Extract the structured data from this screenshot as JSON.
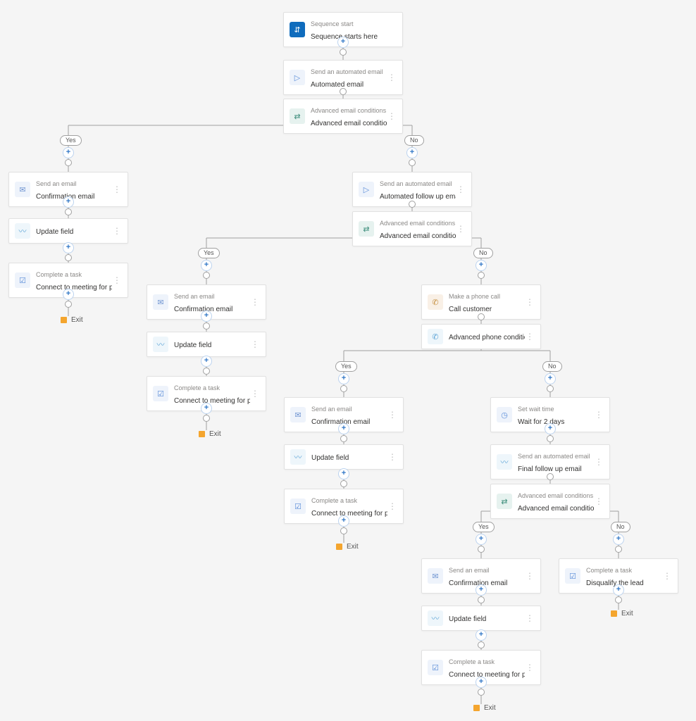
{
  "nodes": {
    "start": {
      "top": "Sequence start",
      "bottom": "Sequence starts here"
    },
    "auto1": {
      "top": "Send an automated email",
      "bottom": "Automated email"
    },
    "cond1": {
      "top": "Advanced email conditions",
      "bottom": "Advanced email conditions"
    },
    "yes1_mail": {
      "top": "Send an email",
      "bottom": "Confirmation email"
    },
    "yes1_upd": {
      "top": "",
      "bottom": "Update field"
    },
    "yes1_task": {
      "top": "Complete a task",
      "bottom": "Connect to meeting for product demo r..."
    },
    "no1_auto": {
      "top": "Send an automated email",
      "bottom": "Automated follow up email"
    },
    "cond2": {
      "top": "Advanced email conditions",
      "bottom": "Advanced email conditions"
    },
    "yes2_mail": {
      "top": "Send an email",
      "bottom": "Confirmation email"
    },
    "yes2_upd": {
      "top": "",
      "bottom": "Update field"
    },
    "yes2_task": {
      "top": "Complete a task",
      "bottom": "Connect to meeting for product demo r..."
    },
    "no2_call": {
      "top": "Make a phone call",
      "bottom": "Call customer"
    },
    "pcond": {
      "top": "",
      "bottom": "Advanced phone condition"
    },
    "yes3_mail": {
      "top": "Send an email",
      "bottom": "Confirmation email"
    },
    "yes3_upd": {
      "top": "",
      "bottom": "Update field"
    },
    "yes3_task": {
      "top": "Complete a task",
      "bottom": "Connect to meeting for product demo r..."
    },
    "no3_wait": {
      "top": "Set wait time",
      "bottom": "Wait for 2 days"
    },
    "no3_auto": {
      "top": "Send an automated email",
      "bottom": "Final follow up email"
    },
    "cond3": {
      "top": "Advanced email conditions",
      "bottom": "Advanced email conditions"
    },
    "yes4_mail": {
      "top": "Send an email",
      "bottom": "Confirmation email"
    },
    "yes4_upd": {
      "top": "",
      "bottom": "Update field"
    },
    "yes4_task": {
      "top": "Complete a task",
      "bottom": "Connect to meeting for product demo r..."
    },
    "no4_task": {
      "top": "Complete a task",
      "bottom": "Disqualify the lead"
    }
  },
  "labels": {
    "yes": "Yes",
    "no": "No",
    "exit": "Exit"
  },
  "glyphs": {
    "start": "⇵",
    "mail_auto": "▷",
    "conditions": "⇄",
    "mail": "✉",
    "update": "〰",
    "task": "☑",
    "phone": "✆",
    "wait": "◷",
    "menu": "⋮",
    "plus": "+"
  }
}
